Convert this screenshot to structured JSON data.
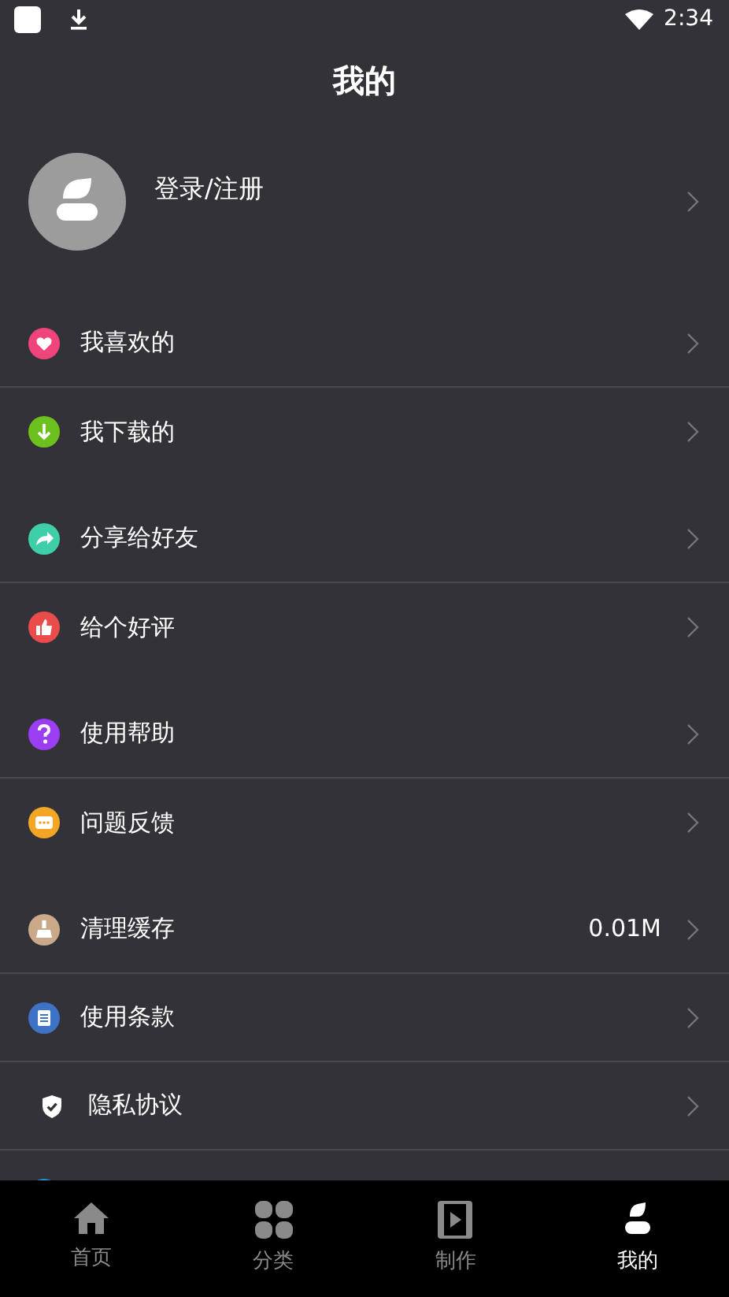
{
  "status_bar": {
    "time": "2:34"
  },
  "header": {
    "title": "我的"
  },
  "profile": {
    "label": "登录/注册"
  },
  "groups": [
    {
      "items": [
        {
          "label": "我喜欢的",
          "color": "#f0457a"
        },
        {
          "label": "我下载的",
          "color": "#6cc11f"
        }
      ]
    },
    {
      "items": [
        {
          "label": "分享给好友",
          "color": "#3ecfa8"
        },
        {
          "label": "给个好评",
          "color": "#ea4b4b"
        }
      ]
    },
    {
      "items": [
        {
          "label": "使用帮助",
          "color": "#9b3df0"
        },
        {
          "label": "问题反馈",
          "color": "#f2a623"
        }
      ]
    },
    {
      "items": [
        {
          "label": "清理缓存",
          "color": "#c9a98a",
          "value": "0.01M"
        },
        {
          "label": "使用条款",
          "color": "#3d72c4"
        },
        {
          "label": "隐私协议",
          "color": "#ffffff"
        },
        {
          "color": "#1e9be0"
        }
      ]
    }
  ],
  "tabs": [
    {
      "label": "首页",
      "selected": false
    },
    {
      "label": "分类",
      "selected": false
    },
    {
      "label": "制作",
      "selected": false
    },
    {
      "label": "我的",
      "selected": true
    }
  ]
}
